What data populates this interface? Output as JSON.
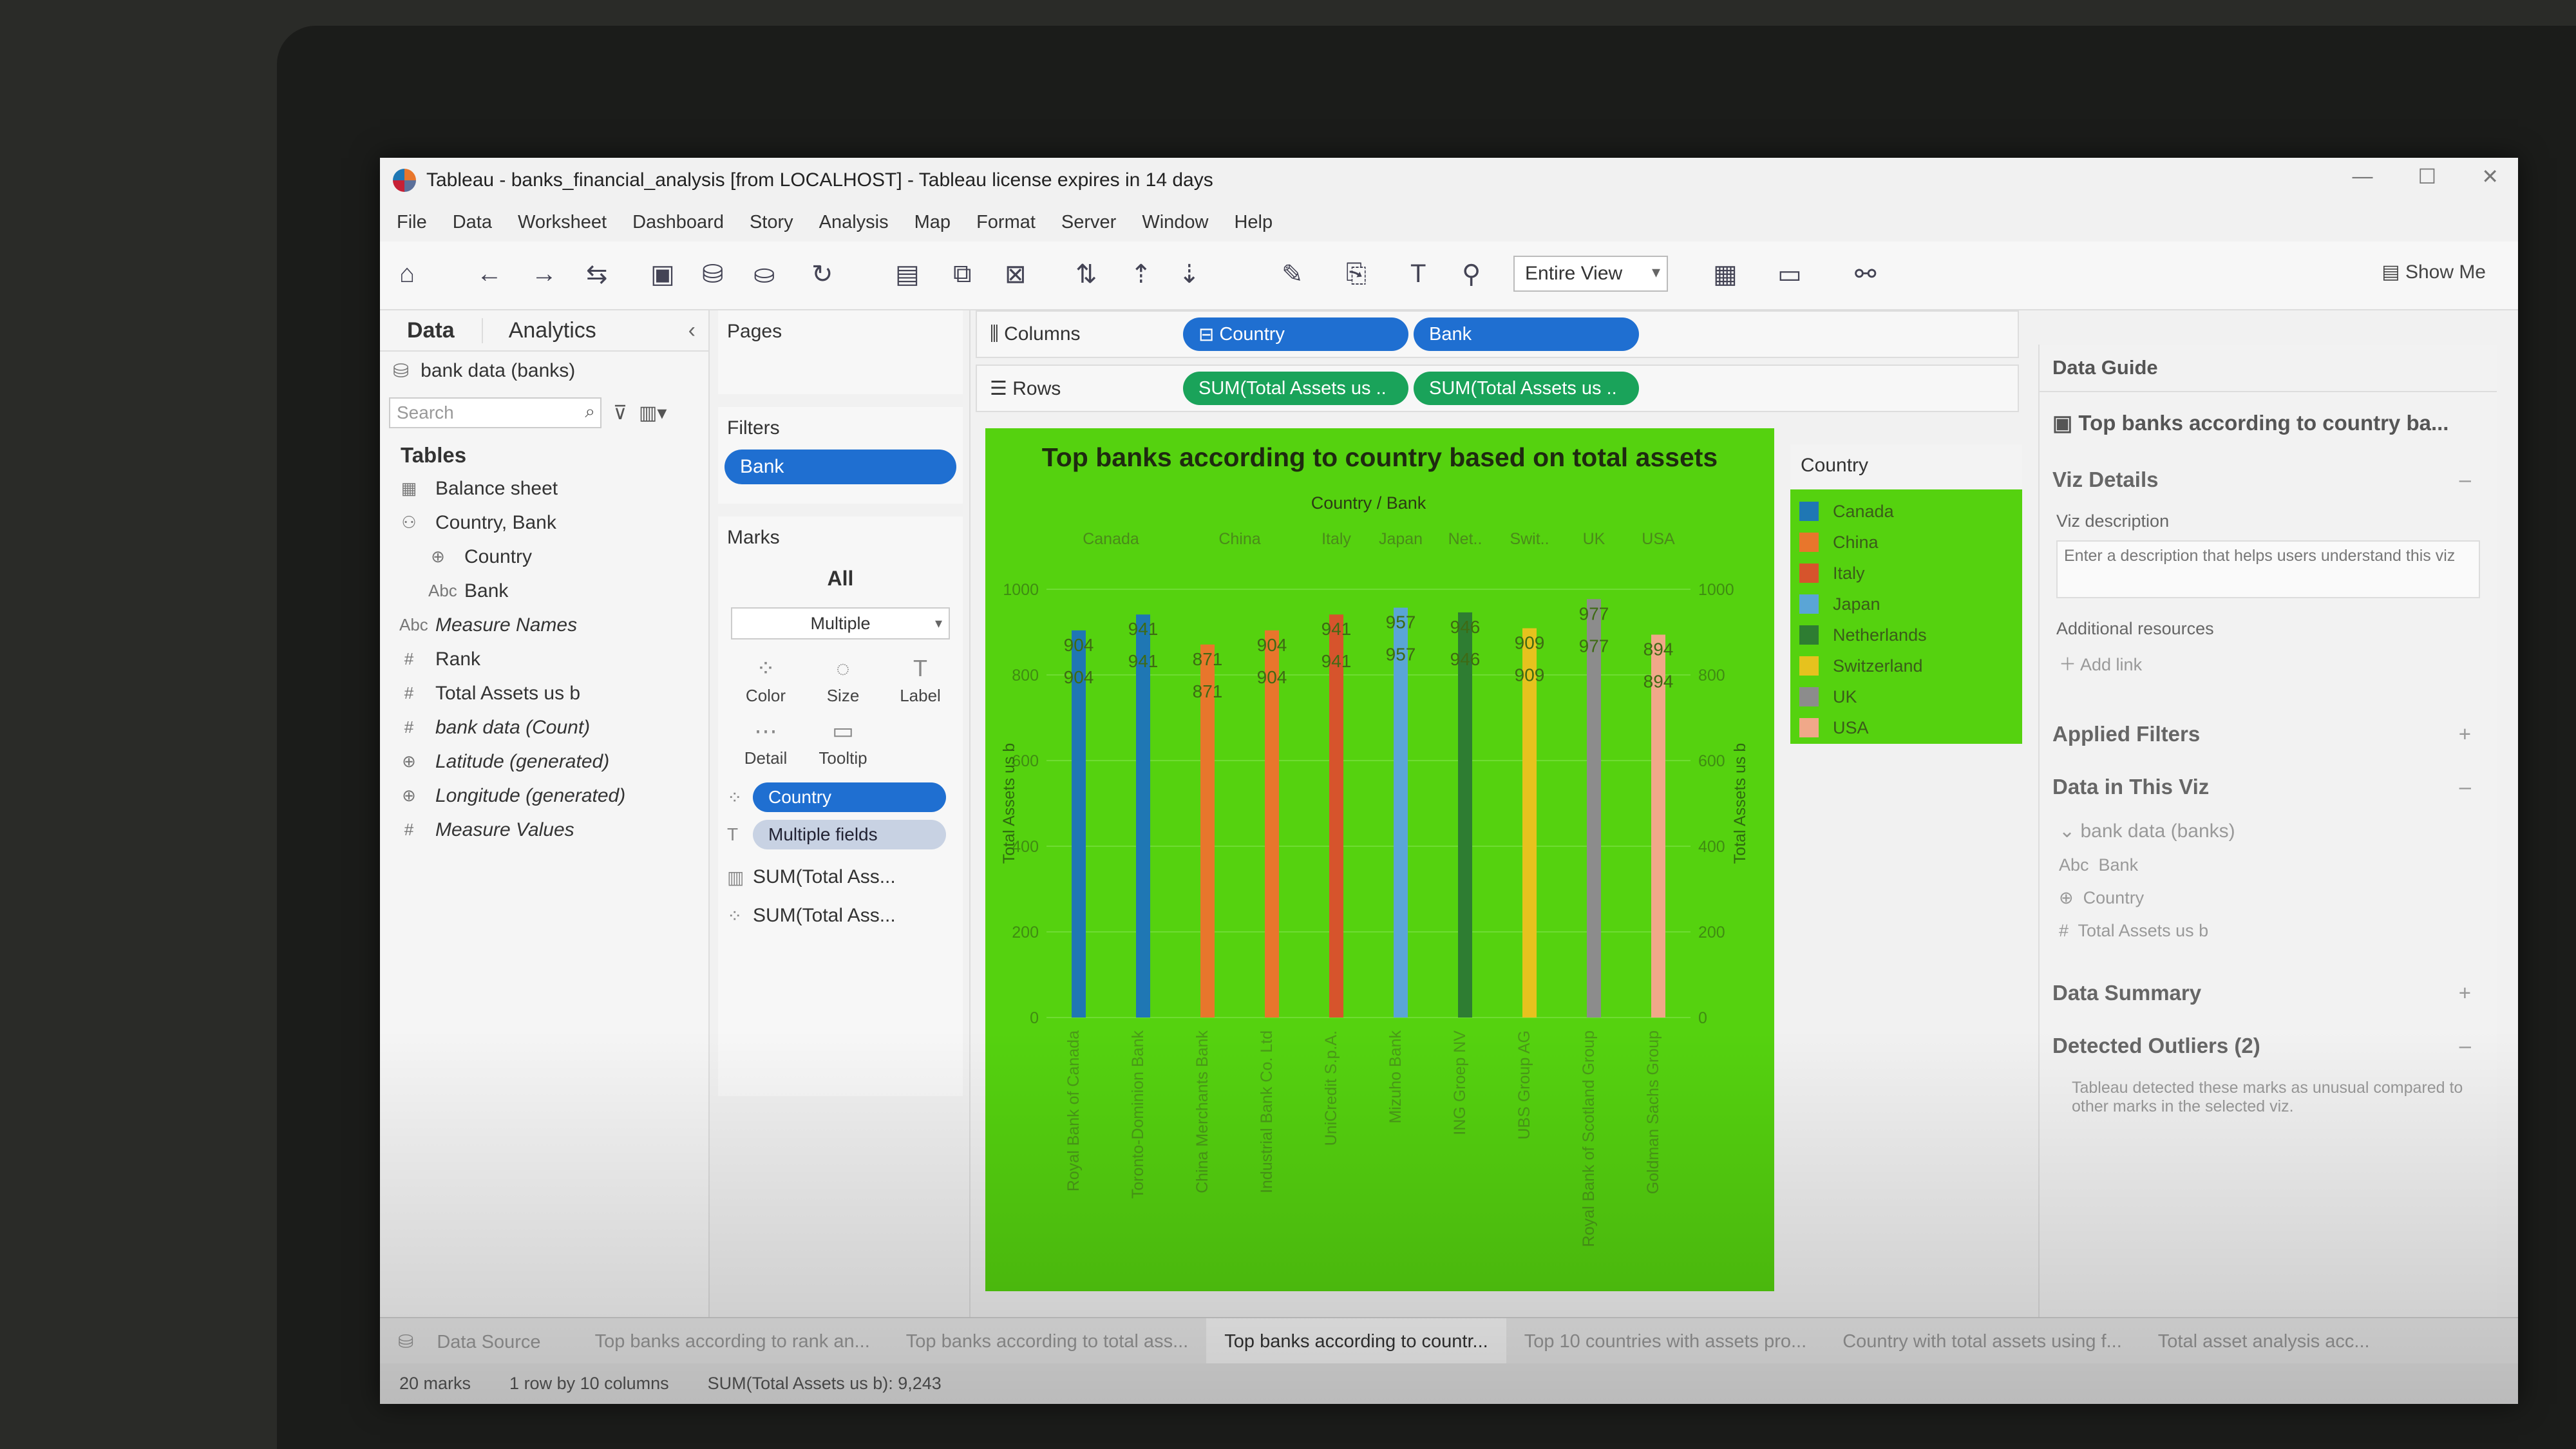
{
  "window": {
    "title": "Tableau - banks_financial_analysis [from LOCALHOST] - Tableau license expires in 14 days",
    "controls": [
      "—",
      "☐",
      "✕"
    ]
  },
  "menu": [
    "File",
    "Data",
    "Worksheet",
    "Dashboard",
    "Story",
    "Analysis",
    "Map",
    "Format",
    "Server",
    "Window",
    "Help"
  ],
  "toolbar": {
    "view_mode": "Entire View",
    "show_me": "Show Me"
  },
  "datapane": {
    "tab_data": "Data",
    "tab_analytics": "Analytics",
    "source": "bank data (banks)",
    "search_placeholder": "Search",
    "tables_label": "Tables",
    "fields": [
      {
        "icon": "▦",
        "label": "Balance sheet",
        "indent": 0,
        "italic": false
      },
      {
        "icon": "⚇",
        "label": "Country, Bank",
        "indent": 0,
        "italic": false
      },
      {
        "icon": "⊕",
        "label": "Country",
        "indent": 1,
        "italic": false
      },
      {
        "icon": "Abc",
        "label": "Bank",
        "indent": 1,
        "italic": false
      },
      {
        "icon": "Abc",
        "label": "Measure Names",
        "indent": 0,
        "italic": true
      },
      {
        "icon": "#",
        "label": "Rank",
        "indent": 0,
        "italic": false
      },
      {
        "icon": "#",
        "label": "Total Assets us b",
        "indent": 0,
        "italic": false
      },
      {
        "icon": "#",
        "label": "bank data (Count)",
        "indent": 0,
        "italic": true
      },
      {
        "icon": "⊕",
        "label": "Latitude (generated)",
        "indent": 0,
        "italic": true
      },
      {
        "icon": "⊕",
        "label": "Longitude (generated)",
        "indent": 0,
        "italic": true
      },
      {
        "icon": "#",
        "label": "Measure Values",
        "indent": 0,
        "italic": true
      }
    ]
  },
  "cards": {
    "pages": "Pages",
    "filters": "Filters",
    "filter_pill": "Bank",
    "marks": "Marks",
    "marks_all": "All",
    "mark_type": "Multiple",
    "buttons": [
      {
        "glyph": "⁘",
        "label": "Color"
      },
      {
        "glyph": "◌",
        "label": "Size"
      },
      {
        "glyph": "T",
        "label": "Label"
      },
      {
        "glyph": "⋯",
        "label": "Detail"
      },
      {
        "glyph": "▭",
        "label": "Tooltip"
      }
    ],
    "mark_fields": [
      {
        "icon": "⁘",
        "label": "Country",
        "kind": "blue"
      },
      {
        "icon": "T",
        "label": "Multiple fields",
        "kind": "grey"
      }
    ],
    "measure_cards": [
      {
        "icon": "▥",
        "label": "SUM(Total Ass..."
      },
      {
        "icon": "⁘",
        "label": "SUM(Total Ass..."
      }
    ]
  },
  "shelves": {
    "columns_label": "Columns",
    "columns": [
      "Country",
      "Bank"
    ],
    "rows_label": "Rows",
    "rows": [
      "SUM(Total Assets us ..",
      "SUM(Total Assets us .."
    ]
  },
  "legend": {
    "title": "Country",
    "items": [
      {
        "label": "Canada",
        "color": "#1f77b4"
      },
      {
        "label": "China",
        "color": "#e8762c"
      },
      {
        "label": "Italy",
        "color": "#d6542c"
      },
      {
        "label": "Japan",
        "color": "#5aa5d6"
      },
      {
        "label": "Netherlands",
        "color": "#2e7d32"
      },
      {
        "label": "Switzerland",
        "color": "#e6c21e"
      },
      {
        "label": "UK",
        "color": "#8c8c8c"
      },
      {
        "label": "USA",
        "color": "#f0a889"
      }
    ]
  },
  "chart_data": {
    "type": "bar",
    "title": "Top banks according to country based on total assets",
    "header": "Country / Bank",
    "ylabel": "Total Assets us b",
    "y2label": "Total Assets us b",
    "ylim": [
      0,
      1000
    ],
    "yticks": [
      0,
      200,
      400,
      600,
      800,
      1000
    ],
    "country_groups": [
      "Canada",
      "China",
      "Italy",
      "Japan",
      "Net..",
      "Swit..",
      "UK",
      "USA"
    ],
    "categories": [
      "Royal Bank of Canada",
      "Toronto-Dominion Bank",
      "China Merchants Bank",
      "Industrial Bank Co. Ltd",
      "UniCredit S.p.A.",
      "Mizuho Bank",
      "ING Groep NV",
      "UBS Group AG",
      "Royal Bank of Scotland Group",
      "Goldman Sachs Group"
    ],
    "countries": [
      "Canada",
      "Canada",
      "China",
      "China",
      "Italy",
      "Japan",
      "Netherlands",
      "Switzerland",
      "UK",
      "USA"
    ],
    "values": [
      904,
      941,
      871,
      904,
      941,
      957,
      946,
      909,
      977,
      894
    ]
  },
  "guide": {
    "title": "Data Guide",
    "sheet": "Top banks according to country ba...",
    "viz_details": "Viz Details",
    "viz_description": "Viz description",
    "desc_placeholder": "Enter a description that helps users understand this viz",
    "additional": "Additional resources",
    "add_link": "Add link",
    "applied_filters": "Applied Filters",
    "data_in_viz": "Data in This Viz",
    "source": "bank data (banks)",
    "fields": [
      "Bank",
      "Country",
      "Total Assets us b"
    ],
    "data_summary": "Data Summary",
    "outliers": "Detected Outliers (2)",
    "outliers_text": "Tableau detected these marks as unusual compared to other marks in the selected viz."
  },
  "sheet_tabs": {
    "data_source": "Data Source",
    "tabs": [
      "Top banks according to rank an...",
      "Top banks according to total ass...",
      "Top banks according to countr...",
      "Top 10 countries with assets pro...",
      "Country with total assets using f...",
      "Total asset analysis acc..."
    ],
    "active": 2
  },
  "status": {
    "marks": "20 marks",
    "rows": "1 row by 10 columns",
    "sum": "SUM(Total Assets us b): 9,243"
  }
}
